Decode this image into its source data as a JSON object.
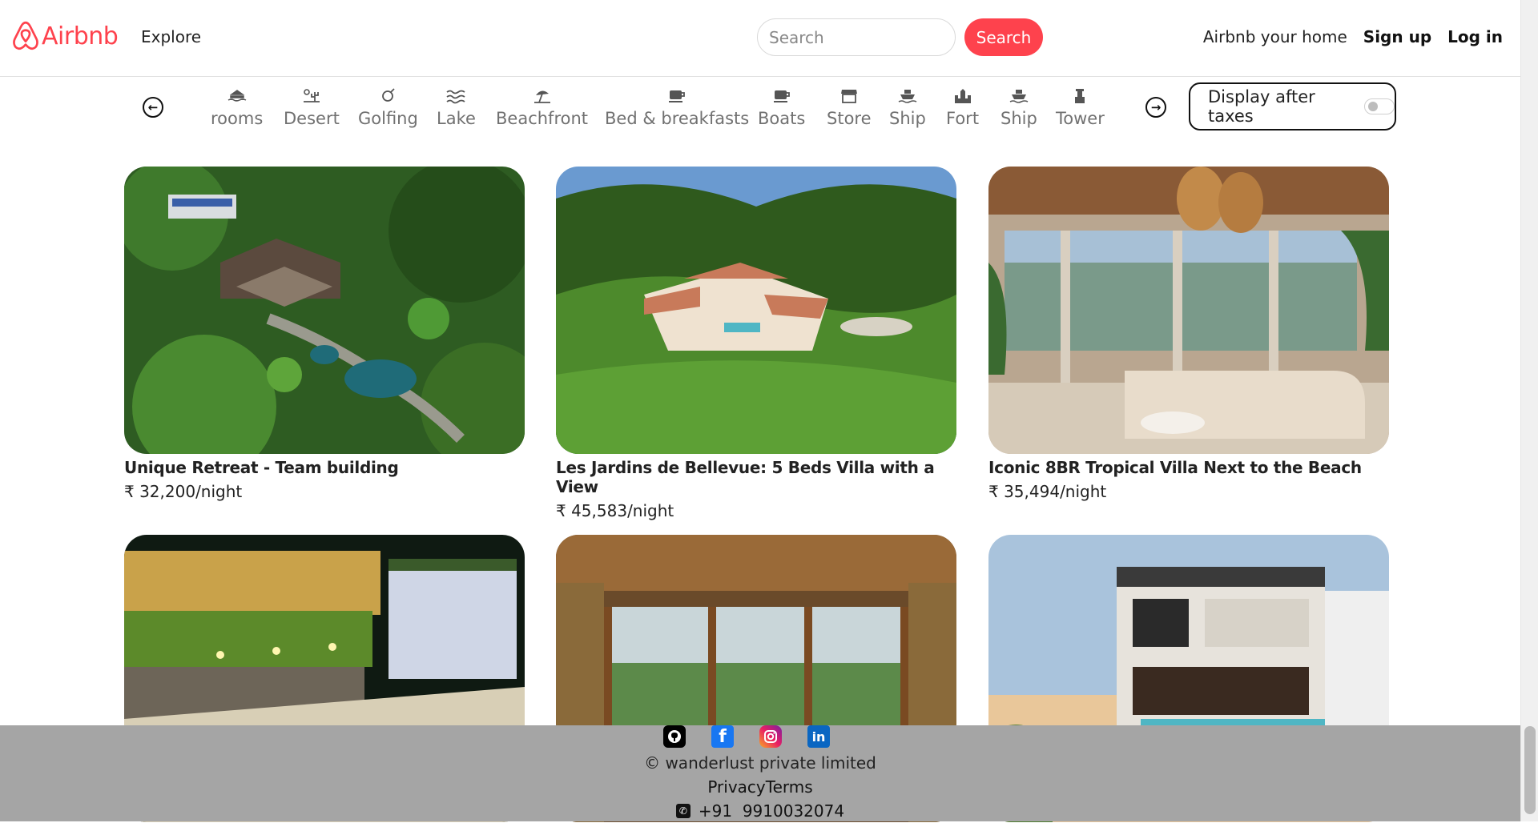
{
  "navbar": {
    "brand": "Airbnb",
    "explore": "Explore",
    "search_placeholder": "Search",
    "search_button": "Search",
    "host": "Airbnb your home",
    "signup": "Sign up",
    "login": "Log in"
  },
  "filters": {
    "items": [
      {
        "label": "rooms",
        "icon": "rooms-icon"
      },
      {
        "label": "Desert",
        "icon": "desert-icon"
      },
      {
        "label": "Golfing",
        "icon": "golfing-icon"
      },
      {
        "label": "Lake",
        "icon": "lake-icon"
      },
      {
        "label": "Beachfront",
        "icon": "beach-umbrella-icon"
      },
      {
        "label": "Bed & breakfasts",
        "icon": "mug-icon"
      },
      {
        "label": "Boats",
        "icon": "mug-icon"
      },
      {
        "label": "Store",
        "icon": "store-icon"
      },
      {
        "label": "Ship",
        "icon": "ship-icon"
      },
      {
        "label": "Fort",
        "icon": "fort-icon"
      },
      {
        "label": "Ship",
        "icon": "ship-icon"
      },
      {
        "label": "Tower",
        "icon": "tower-icon"
      }
    ],
    "tax_toggle_label": "Display after taxes",
    "tax_toggle_on": false
  },
  "listings": [
    {
      "title": "Unique Retreat - Team building",
      "price": "₹ 32,200/night"
    },
    {
      "title": "Les Jardins de Bellevue: 5 Beds Villa with a View",
      "price": "₹ 45,583/night"
    },
    {
      "title": "Iconic 8BR Tropical Villa Next to the Beach",
      "price": "₹ 35,494/night"
    },
    {
      "title": "",
      "price": ""
    },
    {
      "title": "",
      "price": ""
    },
    {
      "title": "",
      "price": ""
    }
  ],
  "footer": {
    "socials": [
      "github-icon",
      "facebook-icon",
      "instagram-icon",
      "linkedin-icon"
    ],
    "copyright": "© wanderlust private limited",
    "privacy": "Privacy",
    "terms": "Terms",
    "phone": "+91  9910032074"
  },
  "colors": {
    "brand": "#fe424d",
    "footer_bg": "#a5a5a5"
  }
}
